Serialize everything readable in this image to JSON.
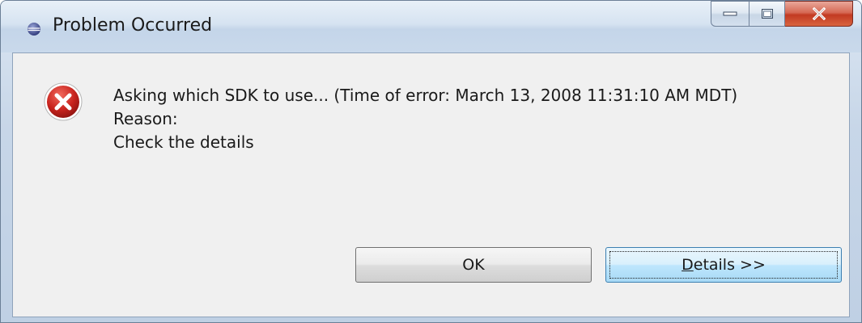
{
  "window": {
    "title": "Problem Occurred",
    "app_icon": "eclipse-icon",
    "caption_buttons": [
      "minimize-icon",
      "maximize-icon",
      "close-icon"
    ],
    "close_color": "#c8432b"
  },
  "message": {
    "icon": "error-icon",
    "icon_color": "#c8231d",
    "line1": "Asking which SDK to use... (Time of error: March 13, 2008 11:31:10 AM MDT)",
    "line2": "Reason:",
    "line3": "Check the details"
  },
  "buttons": {
    "ok_label": "OK",
    "details_mnemonic": "D",
    "details_rest": "etails >>"
  }
}
